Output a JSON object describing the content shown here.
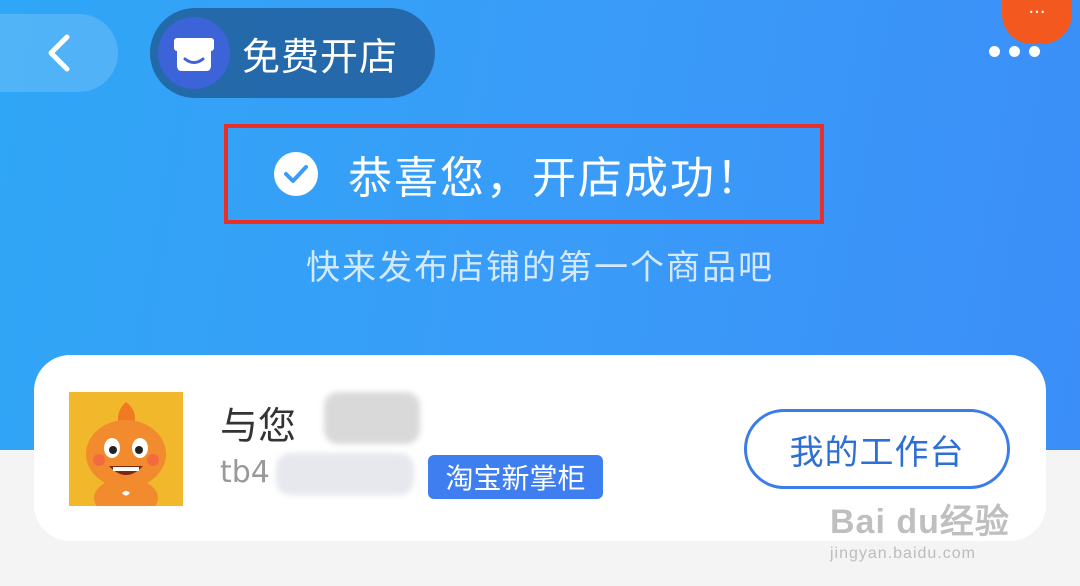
{
  "header": {
    "back_icon": "chevron-left-icon",
    "shop_title": "免费开店",
    "shop_logo_icon": "store-icon",
    "more_icon": "more-dots-icon",
    "float_badge": "···"
  },
  "hero": {
    "success_icon": "check-circle-icon",
    "success_message": "恭喜您，开店成功！",
    "sub_message": "快来发布店铺的第一个商品吧"
  },
  "store_card": {
    "name_visible": "与您",
    "account_visible": "tb4",
    "tag": "淘宝新掌柜",
    "workbench_button": "我的工作台"
  },
  "watermark": {
    "main": "Bai du经验",
    "sub": "jingyan.baidu.com"
  },
  "colors": {
    "hero_blue": "#3a9bf8",
    "highlight_red": "#e8302b",
    "tag_blue": "#3e7ef0",
    "badge_orange": "#f3591e"
  }
}
